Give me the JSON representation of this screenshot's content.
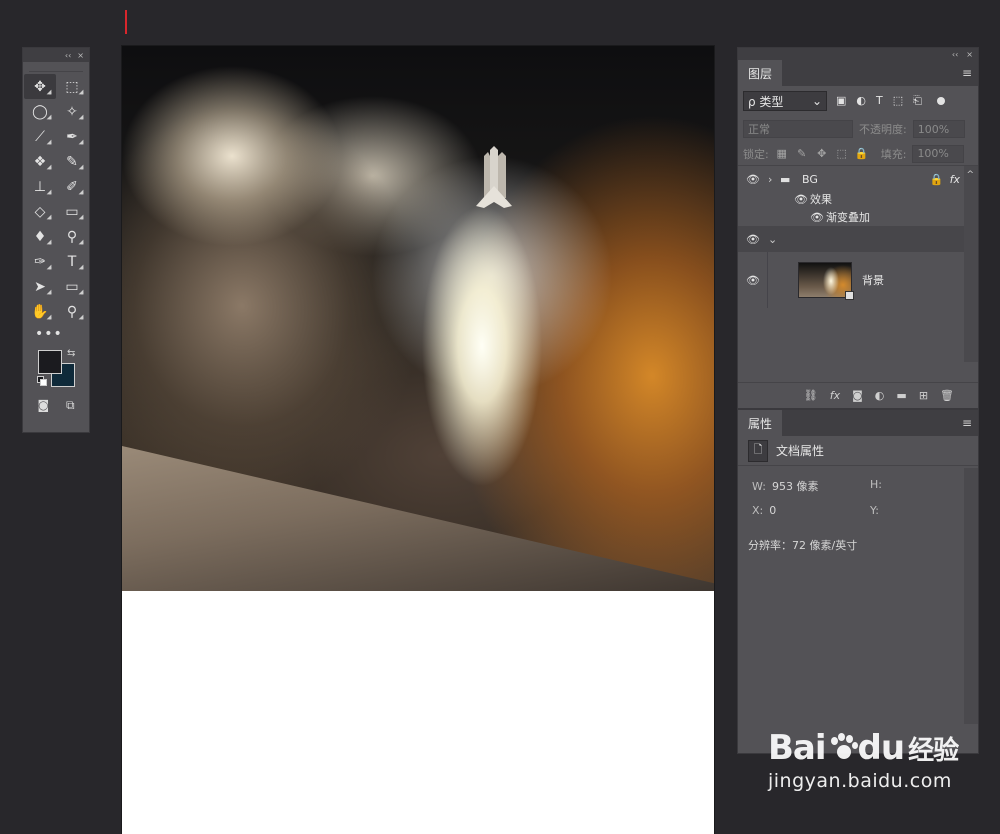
{
  "toolbox": {
    "collapse": "‹‹",
    "close": "×",
    "tools": [
      {
        "name": "move-tool",
        "glyph": "✥",
        "active": true
      },
      {
        "name": "marquee-tool",
        "glyph": "⬚",
        "active": false
      },
      {
        "name": "lasso-tool",
        "glyph": "◯",
        "active": false
      },
      {
        "name": "magic-wand-tool",
        "glyph": "✧",
        "active": false
      },
      {
        "name": "crop-tool",
        "glyph": "⟋",
        "active": false
      },
      {
        "name": "eyedropper-tool",
        "glyph": "✒",
        "active": false
      },
      {
        "name": "healing-brush-tool",
        "glyph": "❖",
        "active": false
      },
      {
        "name": "brush-tool",
        "glyph": "✎",
        "active": false
      },
      {
        "name": "clone-stamp-tool",
        "glyph": "⊥",
        "active": false
      },
      {
        "name": "history-brush-tool",
        "glyph": "✐",
        "active": false
      },
      {
        "name": "eraser-tool",
        "glyph": "◇",
        "active": false
      },
      {
        "name": "gradient-tool",
        "glyph": "▭",
        "active": false
      },
      {
        "name": "blur-tool",
        "glyph": "♦",
        "active": false
      },
      {
        "name": "dodge-tool",
        "glyph": "⚲",
        "active": false
      },
      {
        "name": "pen-tool",
        "glyph": "✑",
        "active": false
      },
      {
        "name": "type-tool",
        "glyph": "T",
        "active": false
      },
      {
        "name": "path-selection-tool",
        "glyph": "➤",
        "active": false
      },
      {
        "name": "rectangle-tool",
        "glyph": "▭",
        "active": false
      },
      {
        "name": "hand-tool",
        "glyph": "✋",
        "active": false
      },
      {
        "name": "zoom-tool",
        "glyph": "⚲",
        "active": false
      }
    ],
    "more": "•••",
    "swap": "⇆",
    "quick_mask": "◙",
    "screen_mode": "⧉"
  },
  "layers_panel": {
    "collapse": "‹‹",
    "close": "×",
    "tab": "图层",
    "menu": "≡",
    "filter_label": "ρ 类型",
    "filter_caret": "⌄",
    "filter_icons": [
      "▣",
      "◐",
      "T",
      "⬚",
      "⎗"
    ],
    "blend_mode": "正常",
    "opacity_label": "不透明度:",
    "opacity_value": "100%",
    "lock_label": "锁定:",
    "lock_icons": [
      "▦",
      "✎",
      "✥",
      "⬚",
      "🔒"
    ],
    "fill_label": "填充:",
    "fill_value": "100%",
    "layers": {
      "group_name": "BG",
      "group_lock": "🔒",
      "group_fx": "fx",
      "effects_label": "效果",
      "gradient_overlay": "渐变叠加",
      "bg_name": "背景"
    },
    "bottom_icons": [
      "⛓",
      "fx",
      "◙",
      "◐",
      "▬",
      "⊞",
      "🗑"
    ]
  },
  "props_panel": {
    "tab": "属性",
    "menu": "≡",
    "doc_props": "文档属性",
    "w_label": "W:",
    "w_value": "953 像素",
    "h_label": "H:",
    "x_label": "X:",
    "x_value": "0",
    "y_label": "Y:",
    "resolution": "分辨率：72 像素/英寸"
  },
  "watermark": {
    "logo_a": "Bai",
    "logo_b": "du",
    "logo_cn": "经验",
    "url": "jingyan.baidu.com"
  },
  "colors": {
    "foreground": "#1b1b1f",
    "background": "#0f2a3a",
    "canvas": "#ffffff"
  }
}
